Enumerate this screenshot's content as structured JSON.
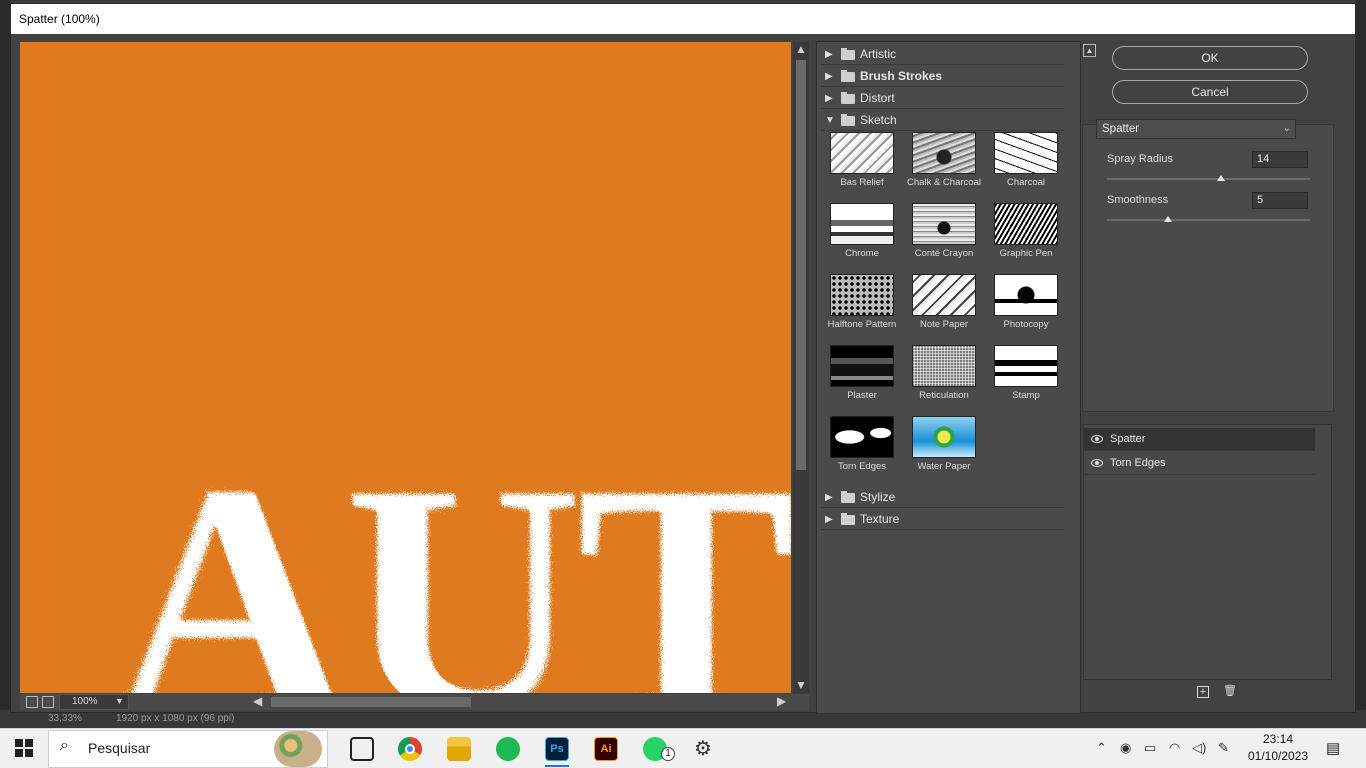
{
  "dialog": {
    "title": "Spatter (100%)",
    "ok_label": "OK",
    "cancel_label": "Cancel",
    "zoom": "100%",
    "preview_text": "AUT"
  },
  "background_status": {
    "zoom": "33,33%",
    "doc_size": "1920 px x 1080 px (96 ppi)"
  },
  "filter_tree": {
    "categories_top": [
      {
        "label": "Artistic",
        "bold": false,
        "expanded": false
      },
      {
        "label": "Brush Strokes",
        "bold": true,
        "expanded": false
      },
      {
        "label": "Distort",
        "bold": false,
        "expanded": false
      },
      {
        "label": "Sketch",
        "bold": false,
        "expanded": true
      }
    ],
    "sketch_filters": [
      {
        "label": "Bas Relief",
        "texture": "basrelief"
      },
      {
        "label": "Chalk & Charcoal",
        "texture": "chalk"
      },
      {
        "label": "Charcoal",
        "texture": "charcoal"
      },
      {
        "label": "Chrome",
        "texture": "chrome"
      },
      {
        "label": "Conté Crayon",
        "texture": "conte"
      },
      {
        "label": "Graphic Pen",
        "texture": "graphicpen"
      },
      {
        "label": "Halftone Pattern",
        "texture": "halftone"
      },
      {
        "label": "Note Paper",
        "texture": "notepaper"
      },
      {
        "label": "Photocopy",
        "texture": "photocopy"
      },
      {
        "label": "Plaster",
        "texture": "plaster"
      },
      {
        "label": "Reticulation",
        "texture": "reticulation"
      },
      {
        "label": "Stamp",
        "texture": "stamp"
      },
      {
        "label": "Torn Edges",
        "texture": "torn"
      },
      {
        "label": "Water Paper",
        "texture": "water"
      }
    ],
    "categories_bottom": [
      {
        "label": "Stylize",
        "bold": false,
        "expanded": false
      },
      {
        "label": "Texture",
        "bold": false,
        "expanded": false
      }
    ]
  },
  "settings": {
    "selected_filter": "Spatter",
    "spray_radius_label": "Spray Radius",
    "spray_radius_value": "14",
    "spray_radius_fraction": 0.56,
    "smoothness_label": "Smoothness",
    "smoothness_value": "5",
    "smoothness_fraction": 0.3
  },
  "effect_layers": [
    {
      "label": "Spatter",
      "selected": true
    },
    {
      "label": "Torn Edges",
      "selected": false
    }
  ],
  "taskbar": {
    "search_placeholder": "Pesquisar",
    "time": "23:14",
    "date": "01/10/2023",
    "whatsapp_badge": "1",
    "apps": [
      "windows-start",
      "task-view",
      "chrome",
      "file-explorer",
      "spotify",
      "photoshop",
      "illustrator",
      "whatsapp",
      "settings"
    ]
  },
  "colors": {
    "preview_orange": "#e07a1e",
    "dialog_bg": "#424242",
    "panel_bg": "#4a4a4a"
  }
}
